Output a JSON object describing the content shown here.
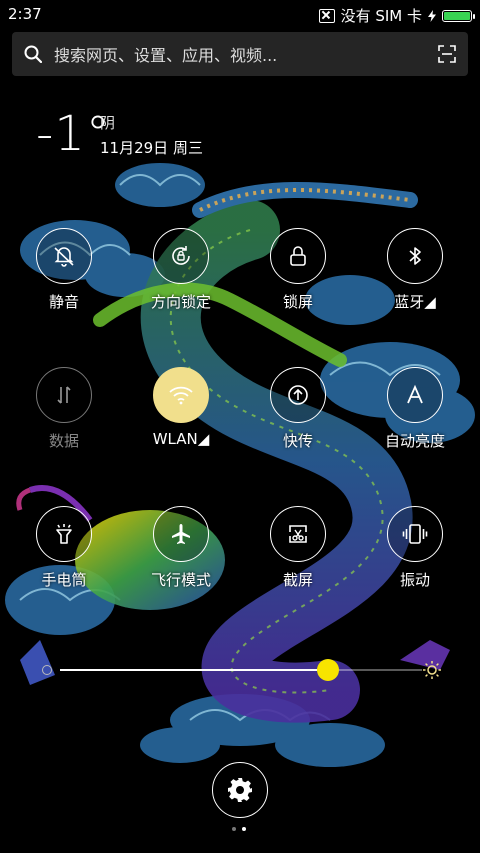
{
  "status_bar": {
    "time": "2:37",
    "carrier": "没有 SIM 卡",
    "battery_level": 1.0,
    "battery_color": "#39d353"
  },
  "search": {
    "placeholder": "搜索网页、设置、应用、视频..."
  },
  "weather": {
    "temperature": "-1°",
    "condition": "阴",
    "date": "11月29日 周三"
  },
  "toggles": [
    {
      "label": "静音",
      "icon": "bell-muted-icon",
      "state": "off"
    },
    {
      "label": "方向锁定",
      "icon": "rotation-lock-icon",
      "state": "off"
    },
    {
      "label": "锁屏",
      "icon": "lock-icon",
      "state": "off"
    },
    {
      "label": "蓝牙◢",
      "icon": "bluetooth-icon",
      "state": "off"
    },
    {
      "label": "数据",
      "icon": "data-arrows-icon",
      "state": "disabled"
    },
    {
      "label": "WLAN◢",
      "icon": "wifi-icon",
      "state": "on"
    },
    {
      "label": "快传",
      "icon": "upload-icon",
      "state": "off"
    },
    {
      "label": "自动亮度",
      "icon": "auto-brightness-icon",
      "state": "off"
    },
    {
      "label": "手电筒",
      "icon": "flashlight-icon",
      "state": "off"
    },
    {
      "label": "飞行模式",
      "icon": "airplane-icon",
      "state": "off"
    },
    {
      "label": "截屏",
      "icon": "screenshot-icon",
      "state": "off"
    },
    {
      "label": "振动",
      "icon": "vibrate-icon",
      "state": "off"
    }
  ],
  "brightness": {
    "level": 0.74,
    "accent": "#f7e400"
  },
  "colors": {
    "active_toggle": "#f1df8c"
  },
  "pages": {
    "count": 2,
    "current": 2
  }
}
